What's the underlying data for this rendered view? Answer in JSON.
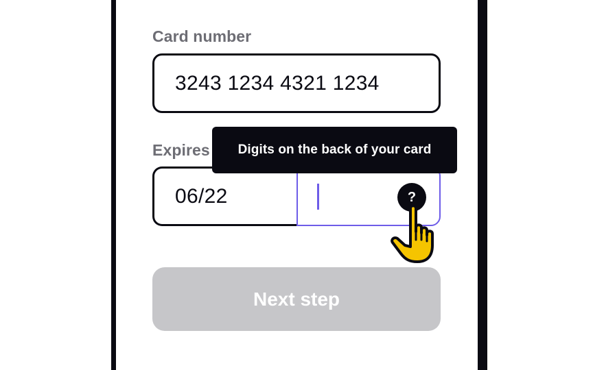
{
  "form": {
    "card_number": {
      "label": "Card number",
      "value": "3243 1234 4321 1234"
    },
    "expiry": {
      "label": "Expires",
      "value": "06/22"
    },
    "cvc": {
      "value": "",
      "help_icon_glyph": "?",
      "tooltip": "Digits on the back of your card"
    },
    "next_button": {
      "label": "Next step",
      "state": "disabled"
    }
  },
  "cursor": {
    "icon": "pointer-hand-icon"
  },
  "colors": {
    "frame": "#0a0a12",
    "label": "#6d6d74",
    "focus_border": "#6d5ce8",
    "button_disabled": "#c6c6c9",
    "cursor_fill": "#f5c400"
  }
}
